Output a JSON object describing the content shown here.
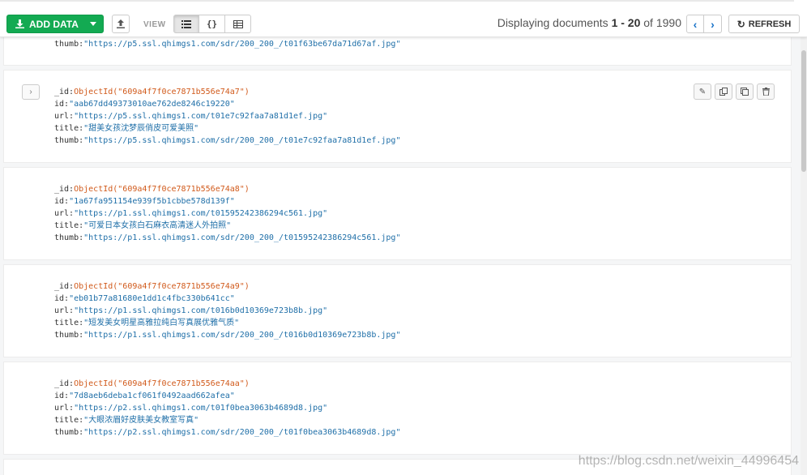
{
  "toolbar": {
    "add_data_label": "ADD DATA",
    "view_label": "VIEW",
    "views": [
      "list",
      "json",
      "table"
    ],
    "paging_prefix": "Displaying documents",
    "paging_range": "1 - 20",
    "paging_of": "of",
    "paging_total": "1990",
    "refresh_label": "REFRESH"
  },
  "partial_doc": {
    "thumb_key": "thumb:",
    "thumb": "\"https://p5.ssl.qhimgs1.com/sdr/200_200_/t01f63be67da71d67af.jpg\""
  },
  "documents": [
    {
      "oid": "ObjectId(\"609a4f7f0ce7871b556e74a7\")",
      "id": "\"aab67dd49373010ae762de8246c19220\"",
      "url": "\"https://p5.ssl.qhimgs1.com/t01e7c92faa7a81d1ef.jpg\"",
      "title": "\"甜美女孩沈梦辰俏皮可爱美照\"",
      "thumb": "\"https://p5.ssl.qhimgs1.com/sdr/200_200_/t01e7c92faa7a81d1ef.jpg\""
    },
    {
      "oid": "ObjectId(\"609a4f7f0ce7871b556e74a8\")",
      "id": "\"1a67fa951154e939f5b1cbbe578d139f\"",
      "url": "\"https://p1.ssl.qhimgs1.com/t01595242386294c561.jpg\"",
      "title": "\"可爱日本女孩白石麻衣高清迷人外拍照\"",
      "thumb": "\"https://p1.ssl.qhimgs1.com/sdr/200_200_/t01595242386294c561.jpg\""
    },
    {
      "oid": "ObjectId(\"609a4f7f0ce7871b556e74a9\")",
      "id": "\"eb01b77a81680e1dd1c4fbc330b641cc\"",
      "url": "\"https://p1.ssl.qhimgs1.com/t016b0d10369e723b8b.jpg\"",
      "title": "\"短发美女明星高雅拉纯白写真展优雅气质\"",
      "thumb": "\"https://p1.ssl.qhimgs1.com/sdr/200_200_/t016b0d10369e723b8b.jpg\""
    },
    {
      "oid": "ObjectId(\"609a4f7f0ce7871b556e74aa\")",
      "id": "\"7d8aeb6deba1cf061f0492aad662afea\"",
      "url": "\"https://p2.ssl.qhimgs1.com/t01f0bea3063b4689d8.jpg\"",
      "title": "\"大眼浓眉好皮肤美女教室写真\"",
      "thumb": "\"https://p2.ssl.qhimgs1.com/sdr/200_200_/t01f0bea3063b4689d8.jpg\""
    }
  ],
  "keys": {
    "oid": "_id:",
    "id": "id:",
    "url": "url:",
    "title": "title:",
    "thumb": "thumb:"
  },
  "watermark": "https://blog.csdn.net/weixin_44996454",
  "colors": {
    "add_button": "#13aa52",
    "object_id": "#d15a1b",
    "string_value": "#1f6fa8",
    "nav_arrow": "#1a73c8"
  }
}
